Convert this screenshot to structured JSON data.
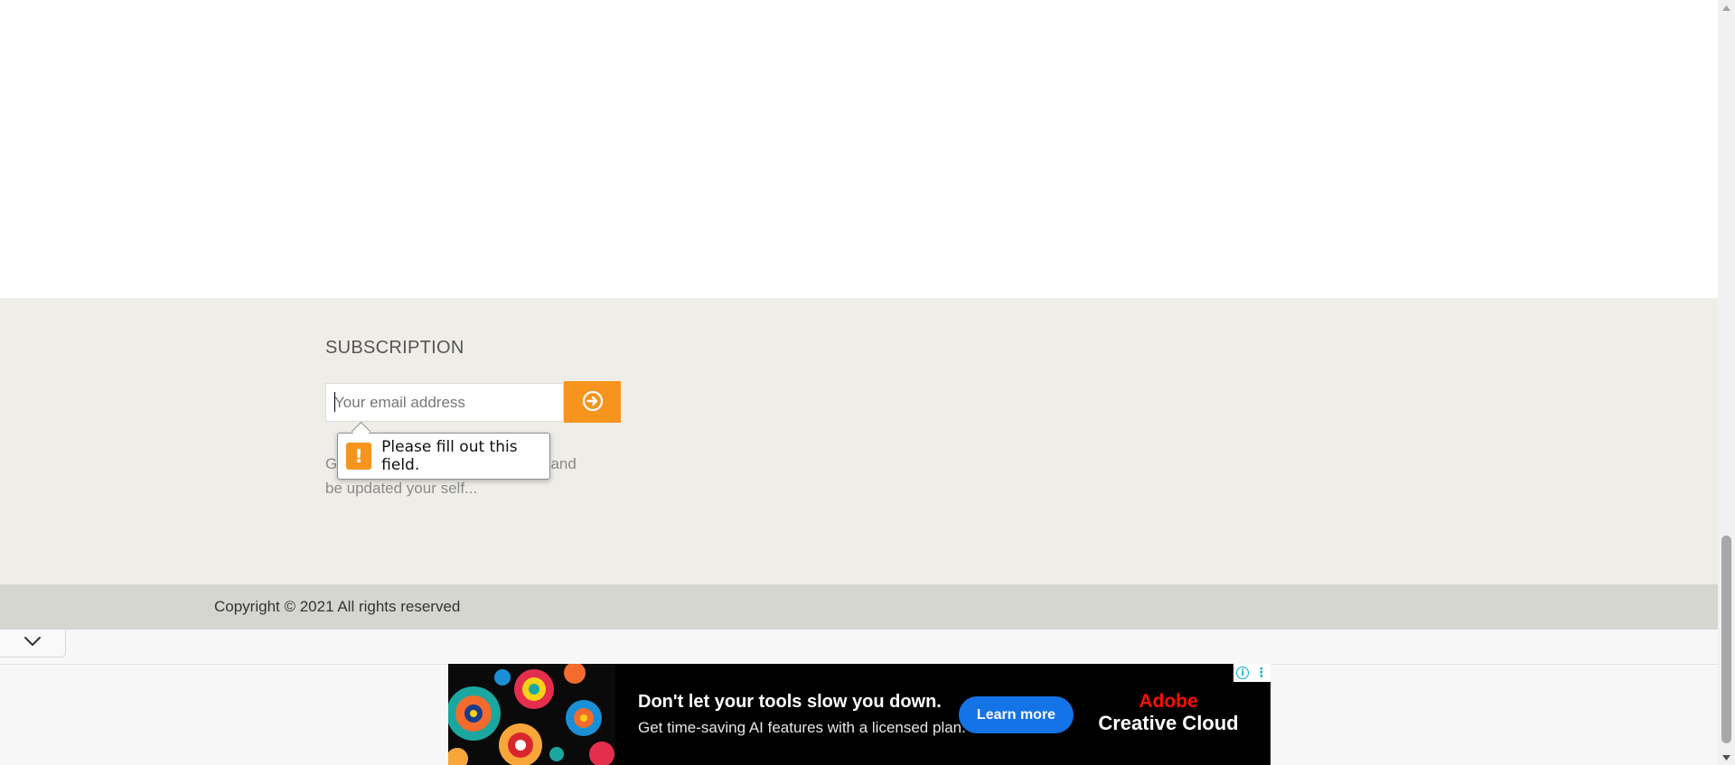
{
  "subscription": {
    "title": "SUBSCRIPTION",
    "email_placeholder": "Your email address",
    "description": "Get the latest news from our site and be updated your self..."
  },
  "validation": {
    "message": "Please fill out this field.",
    "icon_glyph": "!"
  },
  "footer": {
    "copyright": "Copyright © 2021 All rights reserved"
  },
  "ad": {
    "headline": "Don't let your tools slow you down.",
    "subline": "Get time-saving AI features with a licensed plan.",
    "cta": "Learn more",
    "brand_line1": "Adobe",
    "brand_line2": "Creative Cloud",
    "adchoices_info": "i",
    "adchoices_menu": "⋮"
  },
  "colors": {
    "accent": "#f7941d",
    "subscription_bg": "#efede7",
    "copyright_bg": "#d6d6d1",
    "ad_cta": "#1473e6",
    "adobe_red": "#fa0f00"
  },
  "icons": {
    "subscribe": "arrow-circle-right-icon",
    "collapse": "chevron-down-icon",
    "warning": "exclamation-icon"
  }
}
